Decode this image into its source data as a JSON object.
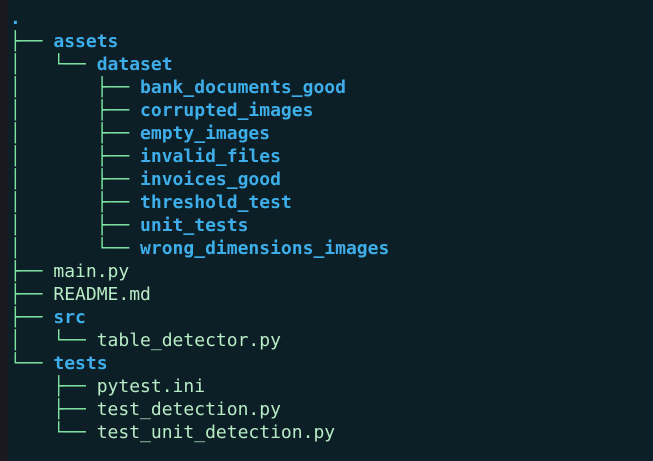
{
  "tree": [
    {
      "prefix": "",
      "name": ".",
      "kind": "root"
    },
    {
      "prefix": "├── ",
      "name": "assets",
      "kind": "dir"
    },
    {
      "prefix": "│   └── ",
      "name": "dataset",
      "kind": "dir"
    },
    {
      "prefix": "│       ├── ",
      "name": "bank_documents_good",
      "kind": "dir"
    },
    {
      "prefix": "│       ├── ",
      "name": "corrupted_images",
      "kind": "dir"
    },
    {
      "prefix": "│       ├── ",
      "name": "empty_images",
      "kind": "dir"
    },
    {
      "prefix": "│       ├── ",
      "name": "invalid_files",
      "kind": "dir"
    },
    {
      "prefix": "│       ├── ",
      "name": "invoices_good",
      "kind": "dir"
    },
    {
      "prefix": "│       ├── ",
      "name": "threshold_test",
      "kind": "dir"
    },
    {
      "prefix": "│       ├── ",
      "name": "unit_tests",
      "kind": "dir"
    },
    {
      "prefix": "│       └── ",
      "name": "wrong_dimensions_images",
      "kind": "dir"
    },
    {
      "prefix": "├── ",
      "name": "main.py",
      "kind": "file"
    },
    {
      "prefix": "├── ",
      "name": "README.md",
      "kind": "file"
    },
    {
      "prefix": "├── ",
      "name": "src",
      "kind": "dir"
    },
    {
      "prefix": "│   └── ",
      "name": "table_detector.py",
      "kind": "file"
    },
    {
      "prefix": "└── ",
      "name": "tests",
      "kind": "dir"
    },
    {
      "prefix": "    ├── ",
      "name": "pytest.ini",
      "kind": "file"
    },
    {
      "prefix": "    ├── ",
      "name": "test_detection.py",
      "kind": "file"
    },
    {
      "prefix": "    └── ",
      "name": "test_unit_detection.py",
      "kind": "file"
    }
  ],
  "colors": {
    "background": "#0d1f26",
    "connector": "#7de3a0",
    "directory": "#3daee9",
    "file": "#b8ecc6"
  }
}
